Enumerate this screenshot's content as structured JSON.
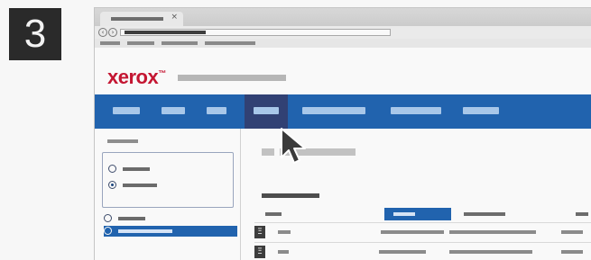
{
  "step": {
    "number": "3"
  },
  "browser": {
    "tab_close": "×",
    "back_glyph": "‹",
    "forward_glyph": "›"
  },
  "app": {
    "brand_logo": "xerox",
    "brand_mark": "™"
  },
  "icons": {
    "document_glyph": "Ξ"
  },
  "colors": {
    "brand_red": "#c8102e",
    "nav_blue": "#1c62b0",
    "nav_active": "#2d3e73",
    "selected_blue": "#1c62b0"
  }
}
